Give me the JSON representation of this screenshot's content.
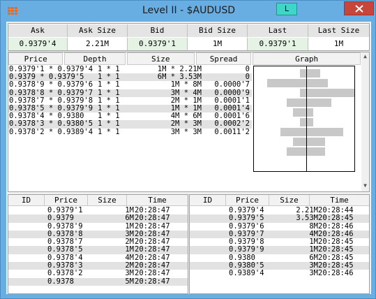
{
  "window": {
    "title": "Level II - $AUDUSD",
    "link_button": "L"
  },
  "quote": {
    "headers": [
      "Ask",
      "Ask Size",
      "Bid",
      "Bid Size",
      "Last",
      "Last Size"
    ],
    "values": [
      "0.9379'4",
      "2.21M",
      "0.9379'1",
      "1M",
      "0.9379'1",
      "1M"
    ]
  },
  "depth": {
    "headers": [
      "Price",
      "Depth",
      "Size",
      "Spread",
      "Graph"
    ],
    "rows": [
      {
        "price": "0.9379'1 * 0.9379'4",
        "depth": "1 * 1",
        "size": "1M * 2.21M",
        "spread": "0"
      },
      {
        "price": "0.9379 * 0.9379'5",
        "depth": "1 * 1",
        "size": "6M * 3.53M",
        "spread": "0"
      },
      {
        "price": "0.9378'9 * 0.9379'6",
        "depth": "1 * 1",
        "size": "1M * 8M",
        "spread": "0.0000'7"
      },
      {
        "price": "0.9378'8 * 0.9379'7",
        "depth": "1 * 1",
        "size": "3M * 4M",
        "spread": "0.0000'9"
      },
      {
        "price": "0.9378'7 * 0.9379'8",
        "depth": "1 * 1",
        "size": "2M * 1M",
        "spread": "0.0001'1"
      },
      {
        "price": "0.9378'5 * 0.9379'9",
        "depth": "1 * 1",
        "size": "1M * 1M",
        "spread": "0.0001'4"
      },
      {
        "price": "0.9378'4 * 0.9380",
        "depth": "1 * 1",
        "size": "4M * 6M",
        "spread": "0.0001'6"
      },
      {
        "price": "0.9378'3 * 0.9380'5",
        "depth": "1 * 1",
        "size": "2M * 3M",
        "spread": "0.0002'2"
      },
      {
        "price": "0.9378'2 * 0.9389'4",
        "depth": "1 * 1",
        "size": "3M * 3M",
        "spread": "0.0011'2"
      }
    ],
    "graph": [
      {
        "bid": 1,
        "ask": 2.21
      },
      {
        "bid": 6,
        "ask": 3.53
      },
      {
        "bid": 1,
        "ask": 8
      },
      {
        "bid": 3,
        "ask": 4
      },
      {
        "bid": 2,
        "ask": 1
      },
      {
        "bid": 1,
        "ask": 1
      },
      {
        "bid": 4,
        "ask": 6
      },
      {
        "bid": 2,
        "ask": 3
      },
      {
        "bid": 3,
        "ask": 3
      }
    ]
  },
  "trades_headers": [
    "ID",
    "Price",
    "Size",
    "Time"
  ],
  "bid_trades": [
    {
      "id": "",
      "price": "0.9379'1",
      "size": "1M",
      "time": "20:28:47"
    },
    {
      "id": "",
      "price": "0.9379",
      "size": "6M",
      "time": "20:28:47"
    },
    {
      "id": "",
      "price": "0.9378'9",
      "size": "1M",
      "time": "20:28:47"
    },
    {
      "id": "",
      "price": "0.9378'8",
      "size": "3M",
      "time": "20:28:47"
    },
    {
      "id": "",
      "price": "0.9378'7",
      "size": "2M",
      "time": "20:28:47"
    },
    {
      "id": "",
      "price": "0.9378'5",
      "size": "1M",
      "time": "20:28:47"
    },
    {
      "id": "",
      "price": "0.9378'4",
      "size": "4M",
      "time": "20:28:47"
    },
    {
      "id": "",
      "price": "0.9378'3",
      "size": "2M",
      "time": "20:28:47"
    },
    {
      "id": "",
      "price": "0.9378'2",
      "size": "3M",
      "time": "20:28:47"
    },
    {
      "id": "",
      "price": "0.9378",
      "size": "5M",
      "time": "20:28:47"
    }
  ],
  "ask_trades": [
    {
      "id": "",
      "price": "0.9379'4",
      "size": "2.21M",
      "time": "20:28:44"
    },
    {
      "id": "",
      "price": "0.9379'5",
      "size": "3.53M",
      "time": "20:28:45"
    },
    {
      "id": "",
      "price": "0.9379'6",
      "size": "8M",
      "time": "20:28:46"
    },
    {
      "id": "",
      "price": "0.9379'7",
      "size": "4M",
      "time": "20:28:46"
    },
    {
      "id": "",
      "price": "0.9379'8",
      "size": "1M",
      "time": "20:28:45"
    },
    {
      "id": "",
      "price": "0.9379'9",
      "size": "1M",
      "time": "20:28:45"
    },
    {
      "id": "",
      "price": "0.9380",
      "size": "6M",
      "time": "20:28:45"
    },
    {
      "id": "",
      "price": "0.9380'5",
      "size": "3M",
      "time": "20:28:45"
    },
    {
      "id": "",
      "price": "0.9389'4",
      "size": "3M",
      "time": "20:28:46"
    }
  ],
  "colors": {
    "titlebar": "#69aee3",
    "link_button": "#3fd6c8",
    "close_button": "#c7463b",
    "row_alt": "#e2e2e2",
    "graph_bar": "#c8c8c8"
  }
}
